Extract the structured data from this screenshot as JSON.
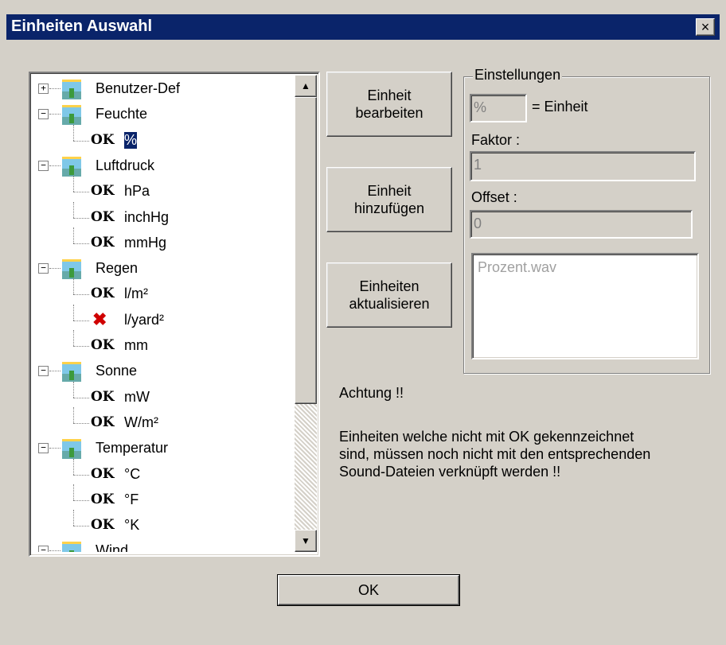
{
  "window": {
    "title": "Einheiten Auswahl",
    "close_label": "×"
  },
  "tree": {
    "nodes": [
      {
        "label": "Benutzer-Def",
        "expander": "+"
      },
      {
        "label": "Feuchte",
        "expander": "−"
      },
      {
        "status": "OK",
        "label": "%"
      },
      {
        "label": "Luftdruck",
        "expander": "−"
      },
      {
        "status": "OK",
        "label": "hPa"
      },
      {
        "status": "OK",
        "label": "inchHg"
      },
      {
        "status": "OK",
        "label": "mmHg"
      },
      {
        "label": "Regen",
        "expander": "−"
      },
      {
        "status": "OK",
        "label": "l/m²"
      },
      {
        "status": "✖",
        "label": "l/yard²"
      },
      {
        "status": "OK",
        "label": "mm"
      },
      {
        "label": "Sonne",
        "expander": "−"
      },
      {
        "status": "OK",
        "label": "mW"
      },
      {
        "status": "OK",
        "label": "W/m²"
      },
      {
        "label": "Temperatur",
        "expander": "−"
      },
      {
        "status": "OK",
        "label": "°C"
      },
      {
        "status": "OK",
        "label": "°F"
      },
      {
        "status": "OK",
        "label": "°K"
      },
      {
        "label": "Wind",
        "expander": "−"
      }
    ],
    "scroll_up": "▲",
    "scroll_down": "▼"
  },
  "buttons": {
    "edit": "Einheit\nbearbeiten",
    "add": "Einheit\nhinzufügen",
    "update": "Einheiten\naktualisieren",
    "ok": "OK"
  },
  "settings": {
    "legend": "Einstellungen",
    "unit_value": "%",
    "unit_suffix": "= Einheit",
    "factor_label": "Faktor :",
    "factor_value": "1",
    "offset_label": "Offset :",
    "offset_value": "0",
    "sound_file": "Prozent.wav"
  },
  "notice": {
    "title": "Achtung !!",
    "text": "Einheiten welche nicht mit OK gekennzeichnet\nsind, müssen noch nicht mit den entsprechenden\nSound-Dateien verknüpft werden !!"
  }
}
